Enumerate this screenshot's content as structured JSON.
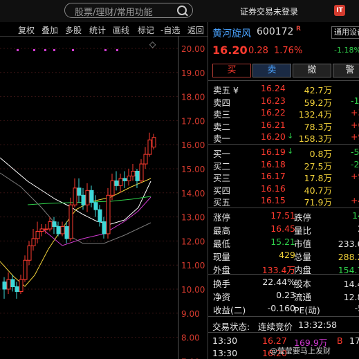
{
  "topbar": {
    "search_placeholder": "股票/理财/常用功能",
    "status_text": "证券交易未登录",
    "icon_a": "IT"
  },
  "toolbar": {
    "items": [
      "复权",
      "叠加",
      "多股",
      "统计",
      "画线",
      "标记",
      "-自选",
      "返回"
    ]
  },
  "chart": {
    "price_ticks": [
      "20.00",
      "19.00",
      "18.00",
      "17.00",
      "16.00",
      "15.00",
      "14.00",
      "13.00",
      "12.00",
      "11.00",
      "10.00",
      "9.00",
      "8.00",
      "7.00"
    ],
    "diamond": "◇"
  },
  "chart_data": {
    "type": "candlestick",
    "y_axis_ticks": [
      20,
      19,
      18,
      17,
      16,
      15,
      14,
      13,
      12,
      11,
      10,
      9,
      8,
      7
    ],
    "ylim": [
      6.7,
      20.3
    ],
    "grid": true
  },
  "quote": {
    "name": "黄河旋风",
    "code": "600172",
    "r_mark": "R",
    "settings_btn": "通用设备",
    "last": "16.20",
    "change": "0.28",
    "pct": "1.76%",
    "sector_change": "-1.18%"
  },
  "trade_buttons": {
    "buy": "买",
    "sell": "卖",
    "cancel": "撤",
    "alert": "警"
  },
  "asks": [
    {
      "label": "卖五 ¥",
      "price": "16.24",
      "arrow": "",
      "vol": "42.7万",
      "extra": "",
      "color": "#ff3b2f"
    },
    {
      "label": "卖四",
      "price": "16.23",
      "arrow": "",
      "vol": "59.2万",
      "extra": "-1",
      "color": "#ff3b2f"
    },
    {
      "label": "卖三",
      "price": "16.22",
      "arrow": "",
      "vol": "132.4万",
      "extra": "+3",
      "color": "#ff3b2f"
    },
    {
      "label": "卖二",
      "price": "16.21",
      "arrow": "",
      "vol": "78.3万",
      "extra": "+6",
      "color": "#ff3b2f"
    },
    {
      "label": "卖一",
      "price": "16.20",
      "arrow": "↓",
      "vol": "158.3万",
      "extra": "+97",
      "color": "#ff3b2f"
    }
  ],
  "bids": [
    {
      "label": "买一",
      "price": "16.19",
      "arrow": "↓",
      "vol": "0.8万",
      "extra": "-5",
      "color": "#ff3b2f"
    },
    {
      "label": "买二",
      "price": "16.18",
      "arrow": "",
      "vol": "27.5万",
      "extra": "-2",
      "color": "#ff3b2f"
    },
    {
      "label": "买三",
      "price": "16.17",
      "arrow": "",
      "vol": "17.8万",
      "extra": "+9",
      "color": "#ff3b2f"
    },
    {
      "label": "买四",
      "price": "16.16",
      "arrow": "",
      "vol": "40.7万",
      "extra": "",
      "color": "#ff3b2f"
    },
    {
      "label": "买五",
      "price": "16.15",
      "arrow": "",
      "vol": "71.9万",
      "extra": "+44",
      "color": "#ff3b2f"
    }
  ],
  "stats": [
    [
      {
        "l": "涨停",
        "v": "17.51",
        "vc": "#ff3b2f"
      },
      {
        "l": "跌停",
        "v": "14.3",
        "vc": "#2fd04a"
      }
    ],
    [
      {
        "l": "最高",
        "v": "16.45",
        "vc": "#ff3b2f"
      },
      {
        "l": "量比",
        "v": "2.0",
        "vc": "#e6e6e6"
      }
    ],
    [
      {
        "l": "最低",
        "v": "15.21",
        "vc": "#2fd04a"
      },
      {
        "l": "市值",
        "v": "233.6亿",
        "vc": "#e6e6e6"
      }
    ],
    [
      {
        "l": "现量",
        "v": "429",
        "vc": "#f2d23a"
      },
      {
        "l": "总量",
        "v": "288.2万",
        "vc": "#f2d23a"
      }
    ],
    [
      {
        "l": "外盘",
        "v": "133.4万",
        "vc": "#ff3b2f"
      },
      {
        "l": "内盘",
        "v": "154.7万",
        "vc": "#2fd04a"
      }
    ]
  ],
  "stats2": [
    [
      {
        "l": "换手",
        "v": "22.44%",
        "vc": "#e6e6e6"
      },
      {
        "l": "股本",
        "v": "14.4亿",
        "vc": "#e6e6e6"
      }
    ],
    [
      {
        "l": "净资",
        "v": "0.23",
        "vc": "#e6e6e6"
      },
      {
        "l": "流通",
        "v": "12.8亿",
        "vc": "#e6e6e6"
      }
    ],
    [
      {
        "l": "收益(二)",
        "v": "-0.160",
        "vc": "#e6e6e6"
      },
      {
        "l": "PE(动)",
        "v": "-52.",
        "vc": "#e6e6e6"
      }
    ]
  ],
  "trade_status": {
    "label": "交易状态:",
    "value": "连续竞价",
    "time": "13:32:58"
  },
  "ticks": [
    {
      "time": "13:30",
      "price": "16.27",
      "vol": "169.9万",
      "bs": "B",
      "n": "17"
    },
    {
      "time": "13:30",
      "price": "16.20",
      "vol": "",
      "bs": "",
      "n": ""
    }
  ],
  "watermark": "@莹莹要马上发财"
}
